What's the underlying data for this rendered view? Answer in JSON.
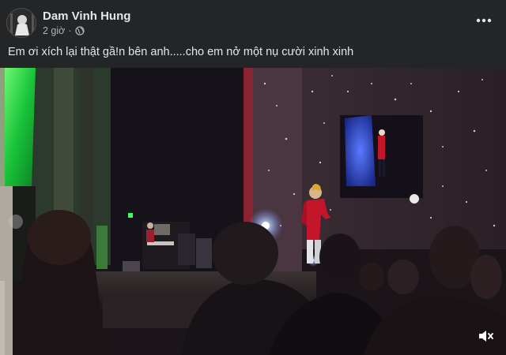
{
  "post": {
    "author": "Dam Vinh Hung",
    "time": "2 giờ",
    "separator": "·",
    "caption": "Em ơi xích lại thật gầ!n bên anh.....cho em nở một nụ cười xinh xinh"
  },
  "icons": {
    "more": "more-horizontal-icon",
    "privacy": "globe-icon",
    "sound": "speaker-muted-icon"
  },
  "colors": {
    "background": "#242526",
    "text_primary": "#e4e6eb",
    "text_secondary": "#b0b3b8",
    "stage_green": "#2fd94a",
    "performer_red": "#c4162a"
  }
}
